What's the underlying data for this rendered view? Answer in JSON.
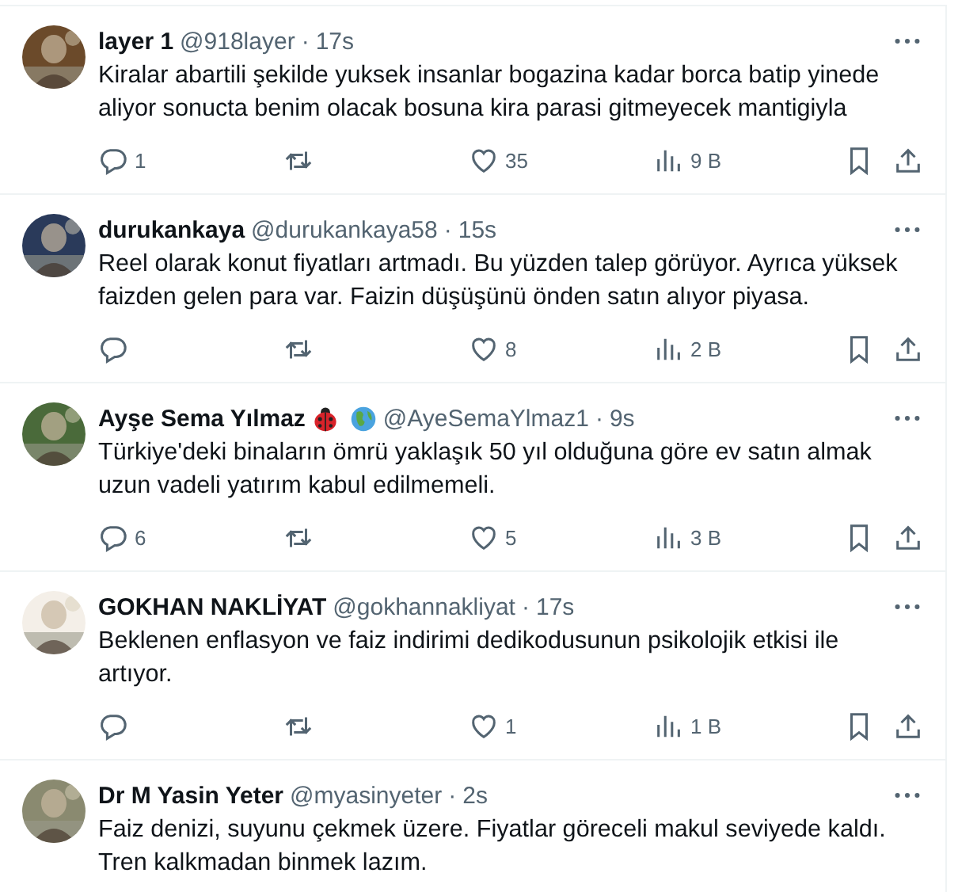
{
  "tweets": [
    {
      "name": "layer 1",
      "handle": "@918layer",
      "separator": "·",
      "time": "17s",
      "text": "Kiralar abartili şekilde yuksek insanlar bogazina kadar borca batip yinede aliyor sonucta benim olacak bosuna kira parasi gitmeyecek mantigiyla",
      "replies": "1",
      "likes": "35",
      "views": "9 B"
    },
    {
      "name": "durukankaya",
      "handle": "@durukankaya58",
      "separator": "·",
      "time": "15s",
      "text": "Reel olarak konut fiyatları artmadı. Bu yüzden talep görüyor. Ayrıca yüksek faizden gelen para var. Faizin düşüşünü önden satın alıyor piyasa.",
      "likes": "8",
      "views": "2 B"
    },
    {
      "name": "Ayşe Sema Yılmaz",
      "badges": [
        {
          "kind": "ladybug"
        },
        {
          "kind": "globe"
        }
      ],
      "handle": "@AyeSemaYlmaz1",
      "separator": "·",
      "time": "9s",
      "text": "Türkiye'deki binaların ömrü yaklaşık 50 yıl olduğuna göre ev satın almak uzun vadeli yatırım kabul edilmemeli.",
      "replies": "6",
      "likes": "5",
      "views": "3 B"
    },
    {
      "name": "GOKHAN NAKLİYAT",
      "handle": "@gokhannakliyat",
      "separator": "·",
      "time": "17s",
      "text": "Beklenen enflasyon ve faiz indirimi dedikodusunun psikolojik etkisi ile artıyor.",
      "likes": "1",
      "views": "1 B"
    },
    {
      "name": "Dr M Yasin Yeter",
      "handle": "@myasinyeter",
      "separator": "·",
      "time": "2s",
      "text": "Faiz denizi, suyunu çekmek üzere. Fiyatlar göreceli makul seviyede kaldı. Tren kalkmadan binmek lazım."
    }
  ]
}
